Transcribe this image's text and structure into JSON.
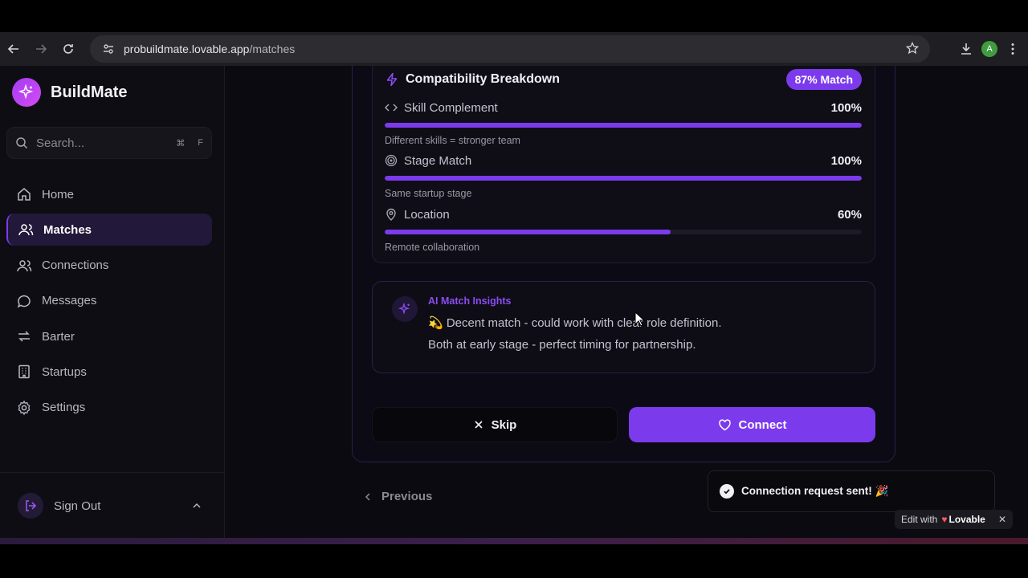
{
  "browser": {
    "url_host": "probuildmate.lovable.app",
    "url_path": "/matches",
    "avatar_letter": "A"
  },
  "sidebar": {
    "app_name": "BuildMate",
    "search_placeholder": "Search...",
    "search_shortcut_1": "⌘",
    "search_shortcut_2": "F",
    "items": [
      {
        "label": "Home",
        "icon": "home-icon"
      },
      {
        "label": "Matches",
        "icon": "users-icon",
        "active": true
      },
      {
        "label": "Connections",
        "icon": "users-icon"
      },
      {
        "label": "Messages",
        "icon": "message-icon"
      },
      {
        "label": "Barter",
        "icon": "swap-icon"
      },
      {
        "label": "Startups",
        "icon": "building-icon"
      },
      {
        "label": "Settings",
        "icon": "gear-icon"
      }
    ],
    "signout_label": "Sign Out"
  },
  "compat": {
    "title": "Compatibility Breakdown",
    "badge": "87% Match",
    "metrics": [
      {
        "label": "Skill Complement",
        "value": "100%",
        "fill": 100,
        "desc": "Different skills = stronger team"
      },
      {
        "label": "Stage Match",
        "value": "100%",
        "fill": 100,
        "desc": "Same startup stage"
      },
      {
        "label": "Location",
        "value": "60%",
        "fill": 60,
        "desc": "Remote collaboration"
      }
    ]
  },
  "insights": {
    "title": "AI Match Insights",
    "line1": "💫 Decent match - could work with clear role definition.",
    "line2": "Both at early stage - perfect timing for partnership."
  },
  "actions": {
    "skip": "Skip",
    "connect": "Connect",
    "previous": "Previous"
  },
  "toast": {
    "text": "Connection request sent! 🎉"
  },
  "lovable": {
    "prefix": "Edit with",
    "brand": "Lovable"
  },
  "colors": {
    "accent": "#7c3aed"
  }
}
